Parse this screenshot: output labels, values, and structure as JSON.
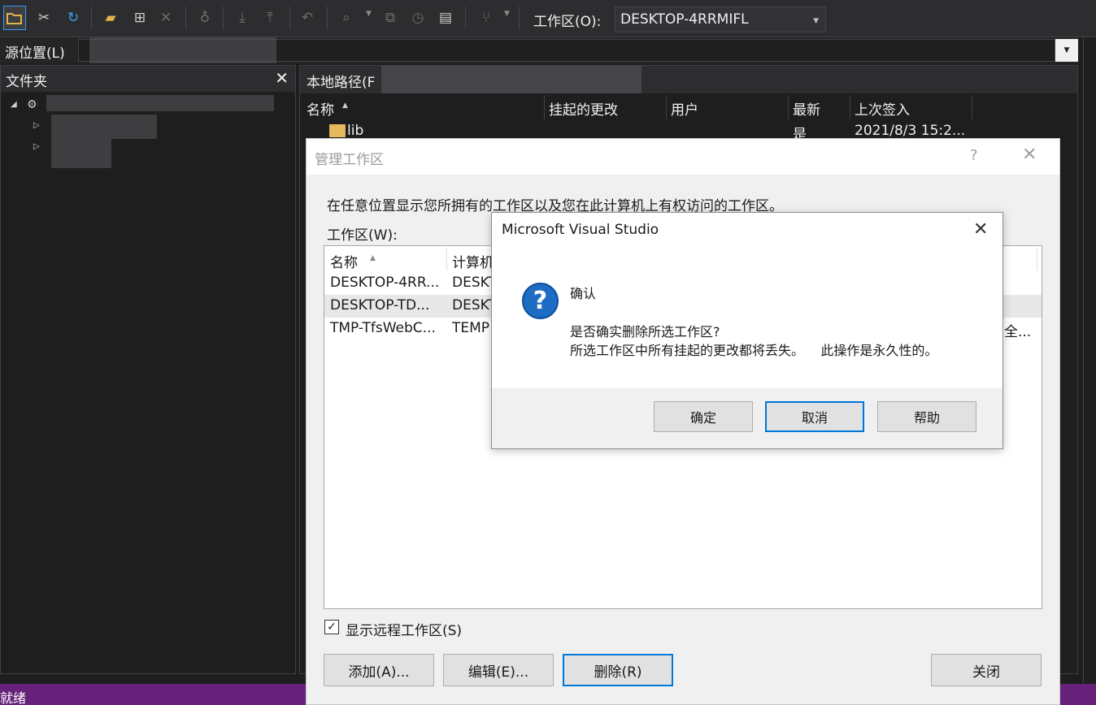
{
  "toolbar": {
    "icons": [
      "open-folder-icon",
      "disconnect-icon",
      "refresh-icon",
      "new-folder-icon",
      "add-item-icon",
      "delete-icon",
      "check-in-icon",
      "get-latest-icon",
      "check-out-icon",
      "undo-icon",
      "compare-icon",
      "view-history-icon",
      "history-icon",
      "shelve-icon",
      "branch-icon"
    ],
    "workspace_label": "工作区(O):",
    "workspace_value": "DESKTOP-4RRMIFL"
  },
  "source": {
    "label": "源位置(L)"
  },
  "folders": {
    "title": "文件夹"
  },
  "local": {
    "title": "本地路径(F",
    "columns": [
      "名称",
      "挂起的更改",
      "用户",
      "最新",
      "上次签入"
    ],
    "rows": [
      {
        "name": "lib",
        "pending": "",
        "user": "",
        "latest": "是",
        "last_checkin": "2021/8/3 15:2..."
      }
    ]
  },
  "manage_dialog": {
    "title": "管理工作区",
    "help": "?",
    "description": "在任意位置显示您所拥有的工作区以及您在此计算机上有权访问的工作区。",
    "list_label": "工作区(W):",
    "columns": [
      "名称",
      "计算机"
    ],
    "rows": [
      {
        "name": "DESKTOP-4RR...",
        "computer": "DESKT",
        "extra": ""
      },
      {
        "name": "DESKTOP-TD...",
        "computer": "DESKT",
        "extra": ""
      },
      {
        "name": "TMP-TfsWebC...",
        "computer": "TEMP",
        "extra": "全..."
      }
    ],
    "show_remote_label": "显示远程工作区(S)",
    "show_remote_checked": true,
    "buttons": {
      "add": "添加(A)...",
      "edit": "编辑(E)...",
      "delete": "删除(R)",
      "close": "关闭"
    }
  },
  "confirm": {
    "title": "Microsoft Visual Studio",
    "heading": "确认",
    "question": "是否确实删除所选工作区?",
    "detail": "所选工作区中所有挂起的更改都将丢失。    此操作是永久性的。",
    "buttons": {
      "ok": "确定",
      "cancel": "取消",
      "help": "帮助"
    }
  },
  "status": {
    "text": "就绪"
  },
  "colors": {
    "accent": "#0078d7",
    "status_bar": "#68217a",
    "question_icon": "#1e6cc4"
  }
}
